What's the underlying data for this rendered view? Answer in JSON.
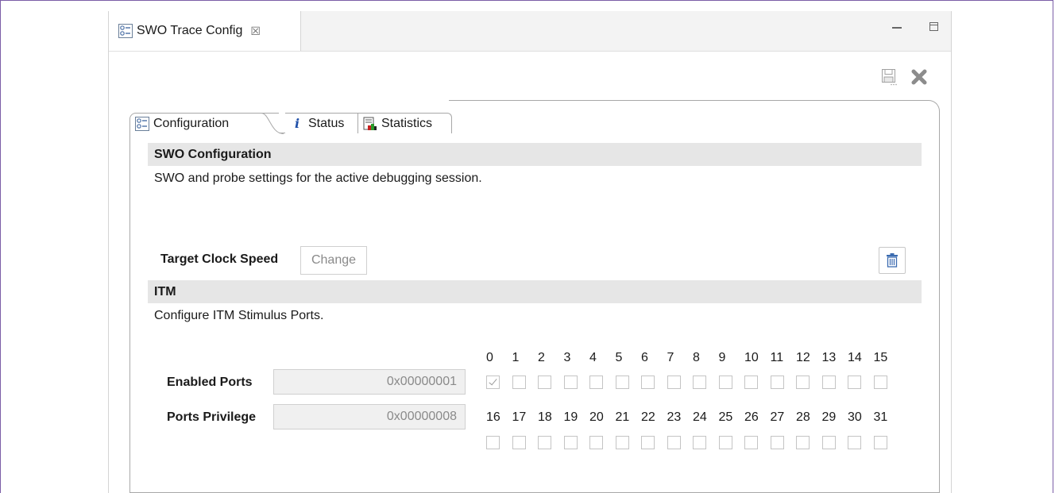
{
  "view": {
    "title": "SWO Trace Config",
    "close_glyph": "☒",
    "icons": [
      "config-icon",
      "minimize-icon",
      "maximize-icon",
      "save-icon",
      "remove-icon"
    ]
  },
  "tabs": [
    {
      "label": "Configuration",
      "icon": "config-icon",
      "selected": true
    },
    {
      "label": "Status",
      "icon": "info-icon",
      "selected": false
    },
    {
      "label": "Statistics",
      "icon": "statistics-icon",
      "selected": false
    }
  ],
  "swo": {
    "header": "SWO Configuration",
    "description": "SWO and probe settings for the active debugging session.",
    "clock_label": "Target Clock Speed",
    "change_button": "Change"
  },
  "itm": {
    "header": "ITM",
    "description": "Configure ITM Stimulus Ports.",
    "enabled_label": "Enabled Ports",
    "enabled_value": "0x00000001",
    "privilege_label": "Ports Privilege",
    "privilege_value": "0x00000008",
    "ports_row1": [
      "0",
      "1",
      "2",
      "3",
      "4",
      "5",
      "6",
      "7",
      "8",
      "9",
      "10",
      "11",
      "12",
      "13",
      "14",
      "15"
    ],
    "ports_row2": [
      "16",
      "17",
      "18",
      "19",
      "20",
      "21",
      "22",
      "23",
      "24",
      "25",
      "26",
      "27",
      "28",
      "29",
      "30",
      "31"
    ],
    "checked_row1": [
      true,
      false,
      false,
      false,
      false,
      false,
      false,
      false,
      false,
      false,
      false,
      false,
      false,
      false,
      false,
      false
    ],
    "checked_row2": [
      false,
      false,
      false,
      false,
      false,
      false,
      false,
      false,
      false,
      false,
      false,
      false,
      false,
      false,
      false,
      false
    ]
  },
  "colors": {
    "frame": "#7b5ea7",
    "section_bg": "#e6e6e6",
    "disabled_text": "#8a8a8a"
  }
}
